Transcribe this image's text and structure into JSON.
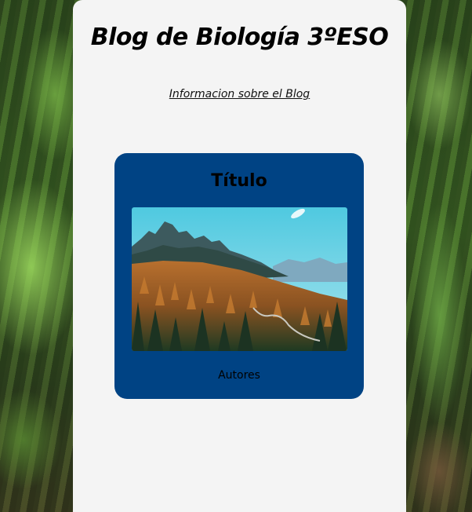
{
  "page": {
    "blog_title": "Blog de Biología 3ºESO",
    "info_link": "Informacion sobre el Blog"
  },
  "card": {
    "title": "Título",
    "authors": "Autores",
    "image_subject": "mountain-forest-landscape"
  },
  "colors": {
    "panel_background": "#f4f4f4",
    "card_background": "#004384",
    "text": "#000000"
  }
}
